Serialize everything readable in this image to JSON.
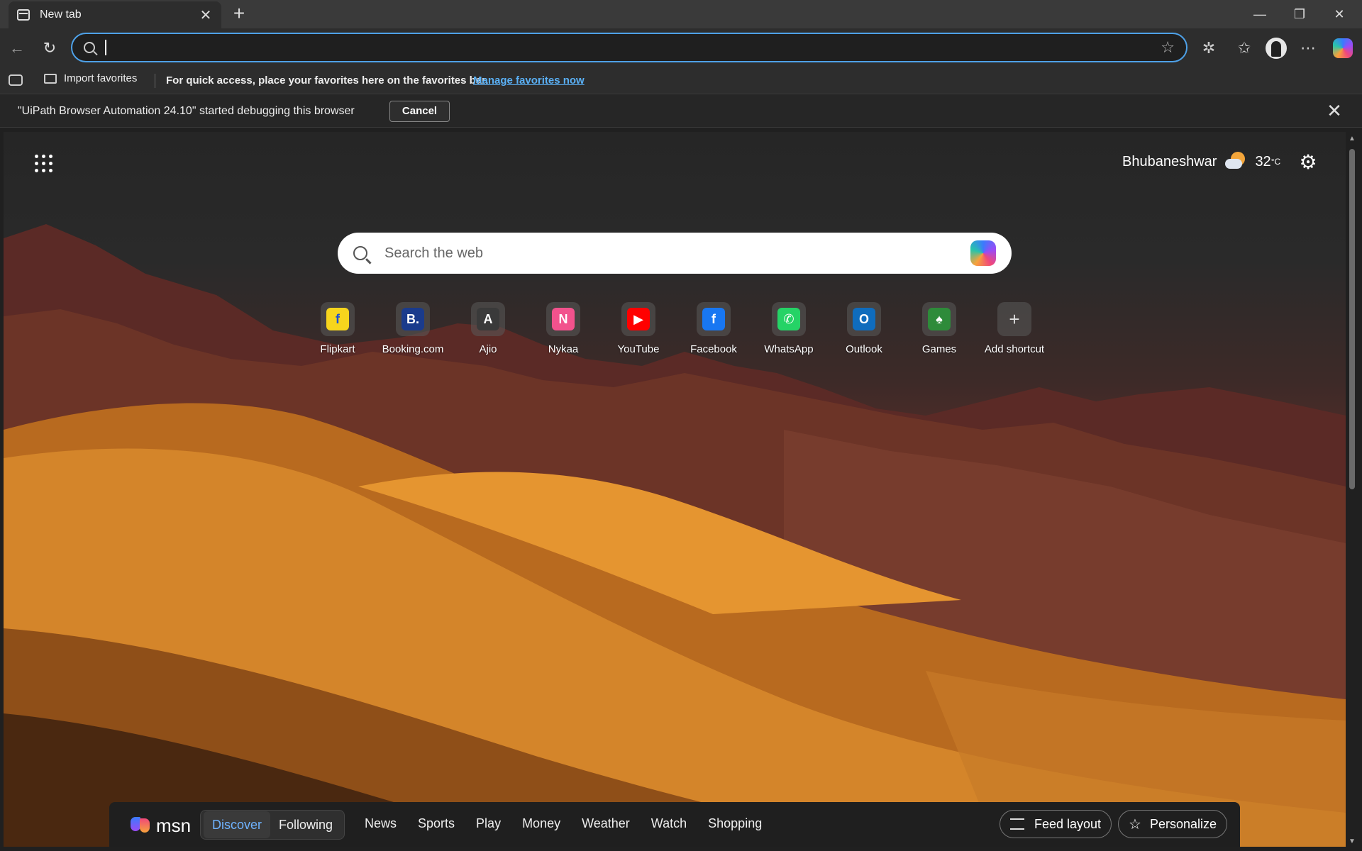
{
  "browser": {
    "tab": {
      "title": "New tab",
      "icon": "new-tab-page-icon",
      "close_icon": "close-icon"
    },
    "new_tab_icon": "plus-icon",
    "window_controls": [
      "minimize-icon",
      "restore-icon",
      "close-icon"
    ],
    "address_bar": {
      "value": "",
      "placeholder": "",
      "icon": "search-icon",
      "favorite_icon": "star-icon"
    },
    "toolbar_icons": [
      "extensions-icon",
      "favorites-icon",
      "profile-avatar",
      "more-icon",
      "copilot-icon"
    ]
  },
  "favorites_bar": {
    "import_label": "Import favorites",
    "message": "For quick access, place your favorites here on the favorites bar.",
    "manage_link": "Manage favorites now"
  },
  "debug_bar": {
    "message": "\"UiPath Browser Automation 24.10\" started debugging this browser",
    "cancel_label": "Cancel"
  },
  "ntp": {
    "weather": {
      "city": "Bhubaneshwar",
      "temp": "32",
      "unit": "°C",
      "icon": "partly-cloudy-icon"
    },
    "search": {
      "placeholder": "Search the web"
    },
    "shortcuts": [
      {
        "label": "Flipkart",
        "icon": "flipkart-icon",
        "color": "#f7d51d"
      },
      {
        "label": "Booking.com",
        "icon": "booking-icon",
        "color": "#1a3b8c"
      },
      {
        "label": "Ajio",
        "icon": "ajio-icon",
        "color": "#3a3a3a"
      },
      {
        "label": "Nykaa",
        "icon": "nykaa-icon",
        "color": "#f2528d"
      },
      {
        "label": "YouTube",
        "icon": "youtube-icon",
        "color": "#ff0000"
      },
      {
        "label": "Facebook",
        "icon": "facebook-icon",
        "color": "#1877f2"
      },
      {
        "label": "WhatsApp",
        "icon": "whatsapp-icon",
        "color": "#25d366"
      },
      {
        "label": "Outlook",
        "icon": "outlook-icon",
        "color": "#0f6cbd"
      },
      {
        "label": "Games",
        "icon": "games-icon",
        "color": "#2e8b3a"
      },
      {
        "label": "Add shortcut",
        "icon": "plus-icon",
        "color": "#5a5a5a"
      }
    ]
  },
  "msn_bar": {
    "logo_text": "msn",
    "pills": [
      "Discover",
      "Following"
    ],
    "active_pill": "Discover",
    "nav": [
      "News",
      "Sports",
      "Play",
      "Money",
      "Weather",
      "Watch",
      "Shopping"
    ],
    "feed_layout_label": "Feed layout",
    "personalize_label": "Personalize"
  }
}
